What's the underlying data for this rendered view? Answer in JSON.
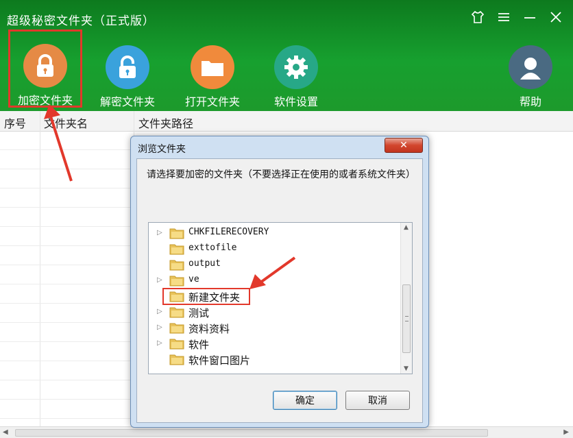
{
  "app": {
    "title": "超级秘密文件夹（正式版）"
  },
  "toolbar": {
    "encrypt_label": "加密文件夹",
    "decrypt_label": "解密文件夹",
    "open_label": "打开文件夹",
    "settings_label": "软件设置",
    "help_label": "帮助"
  },
  "table": {
    "columns": [
      "序号",
      "文件夹名",
      "文件夹路径"
    ]
  },
  "dialog": {
    "title": "浏览文件夹",
    "prompt": "请选择要加密的文件夹（不要选择正在使用的或者系统文件夹）",
    "tree_items": [
      {
        "name": "CHKFILERECOVERY",
        "expandable": true
      },
      {
        "name": "exttofile",
        "expandable": false
      },
      {
        "name": "output",
        "expandable": false
      },
      {
        "name": "ve",
        "expandable": true
      },
      {
        "name": "新建文件夹",
        "expandable": false,
        "highlighted": true
      },
      {
        "name": "测试",
        "expandable": true
      },
      {
        "name": "资料资料",
        "expandable": true
      },
      {
        "name": "软件",
        "expandable": true
      },
      {
        "name": "软件窗口图片",
        "expandable": false
      }
    ],
    "ok_label": "确定",
    "cancel_label": "取消"
  },
  "colors": {
    "header_green": "#17a02f",
    "annotation_red": "#e2382b"
  }
}
